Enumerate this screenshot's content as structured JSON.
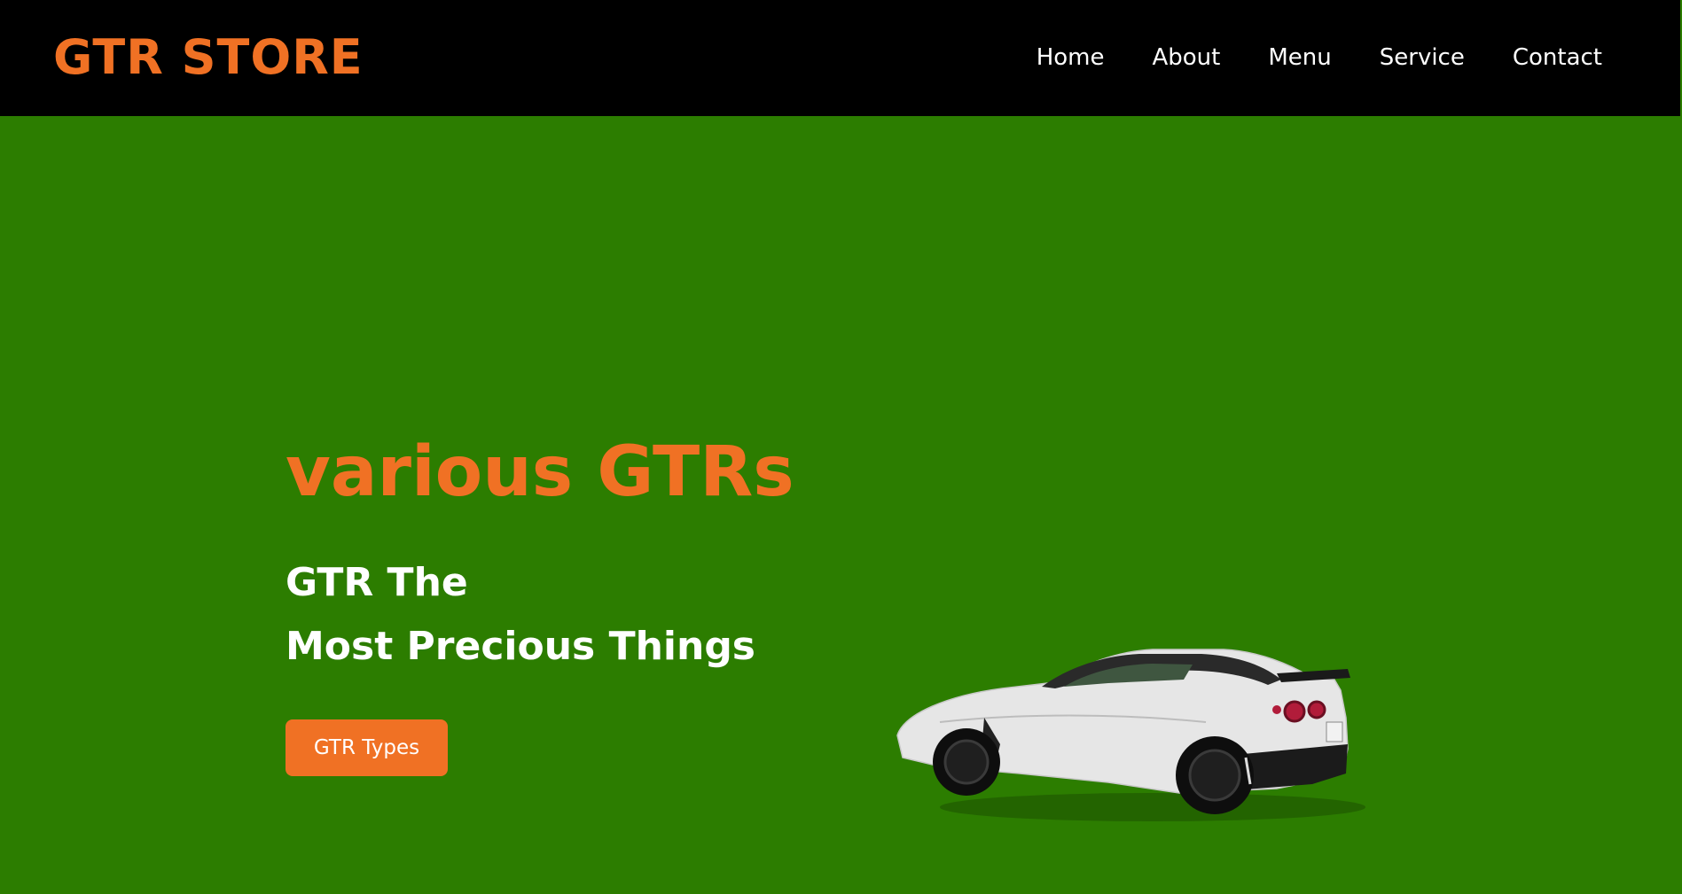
{
  "header": {
    "logo": "GTR STORE",
    "nav": [
      {
        "label": "Home"
      },
      {
        "label": "About"
      },
      {
        "label": "Menu"
      },
      {
        "label": "Service"
      },
      {
        "label": "Contact"
      }
    ]
  },
  "hero": {
    "title": "various GTRs",
    "subtitle_line1": "GTR The",
    "subtitle_line2": "Most Precious Things",
    "cta_label": "GTR Types",
    "image_icon": "car-image"
  },
  "colors": {
    "accent": "#f07124",
    "header_bg": "#000000",
    "hero_bg": "#2c7d00",
    "text_light": "#ffffff"
  }
}
